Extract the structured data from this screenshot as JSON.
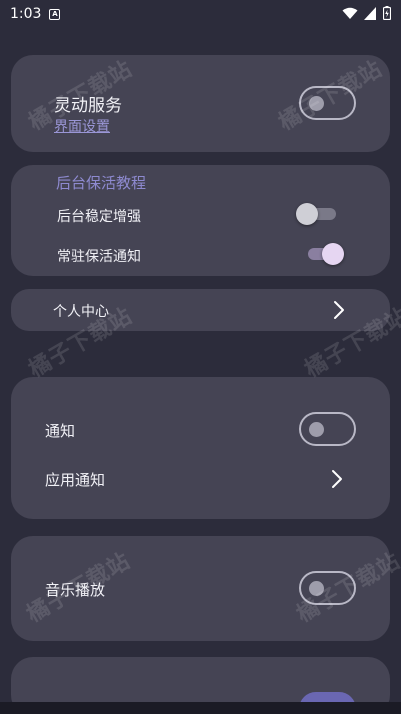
{
  "status_bar": {
    "time": "1:03",
    "sim_badge": "A"
  },
  "dynamic_service_card": {
    "title": "灵动服务",
    "settings_link": "界面设置",
    "toggle_on": false
  },
  "background_card": {
    "section_title": "后台保活教程",
    "rows": [
      {
        "label": "后台稳定增强",
        "toggle_on": false
      },
      {
        "label": "常驻保活通知",
        "toggle_on": true
      }
    ]
  },
  "personal_center": {
    "label": "个人中心"
  },
  "notification_card": {
    "notify_label": "通知",
    "notify_toggle_on": false,
    "app_notify_label": "应用通知"
  },
  "music_card": {
    "label": "音乐播放",
    "toggle_on": false
  },
  "watermark_text": "橘子下载站",
  "colors": {
    "background": "#2c2c3b",
    "card": "#454454",
    "accent_link": "#9a96d6",
    "section_title": "#8e8ad0"
  }
}
